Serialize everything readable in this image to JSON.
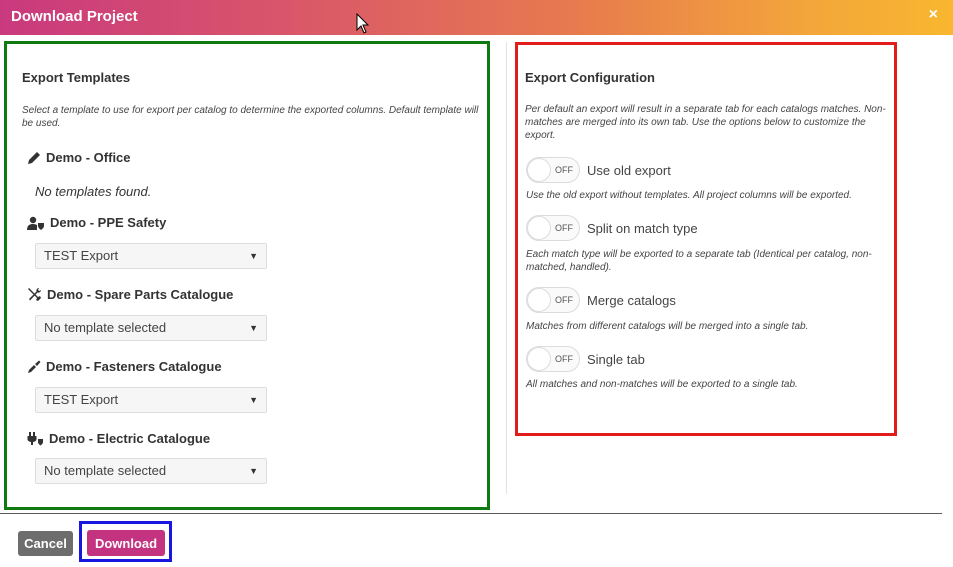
{
  "window": {
    "title": "Download Project",
    "close_symbol": "×"
  },
  "templates": {
    "heading": "Export Templates",
    "description": "Select a template to use for export per catalog to determine the exported columns. Default template will be used.",
    "catalogs": [
      {
        "name": "Demo - Office",
        "icon": "pencil-icon",
        "empty_text": "No templates found."
      },
      {
        "name": "Demo - PPE Safety",
        "icon": "user-shield-icon",
        "selected": "TEST Export"
      },
      {
        "name": "Demo - Spare Parts Catalogue",
        "icon": "tools-icon",
        "selected": "No template selected"
      },
      {
        "name": "Demo - Fasteners Catalogue",
        "icon": "screwdriver-icon",
        "selected": "TEST Export"
      },
      {
        "name": "Demo - Electric Catalogue",
        "icon": "plug-icon",
        "selected": "No template selected"
      }
    ]
  },
  "config": {
    "heading": "Export Configuration",
    "description": "Per default an export will result in a separate tab for each catalogs matches. Non-matches are merged into its own tab. Use the options below to customize the export.",
    "toggles": [
      {
        "label": "Use old export",
        "state": "OFF",
        "description": "Use the old export without templates. All project columns will be exported."
      },
      {
        "label": "Split on match type",
        "state": "OFF",
        "description": "Each match type will be exported to a separate tab (Identical per catalog, non-matched, handled)."
      },
      {
        "label": "Merge catalogs",
        "state": "OFF",
        "description": "Matches from different catalogs will be merged into a single tab."
      },
      {
        "label": "Single tab",
        "state": "OFF",
        "description": "All matches and non-matches will be exported to a single tab."
      }
    ]
  },
  "footer": {
    "cancel_label": "Cancel",
    "download_label": "Download"
  },
  "colors": {
    "accent": "#c4337f",
    "cancel": "#6d6d6d",
    "gradient_start": "#c9397e",
    "gradient_end": "#f8b72f"
  }
}
